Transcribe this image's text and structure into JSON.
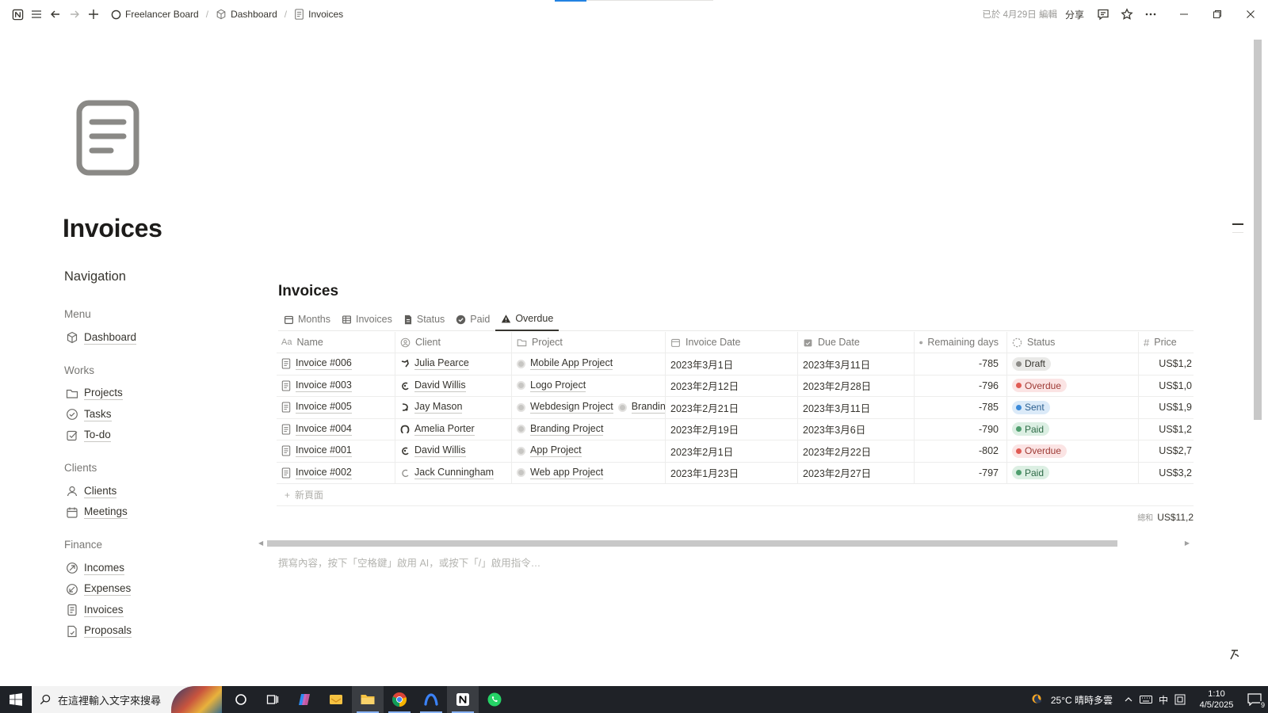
{
  "topbar": {
    "breadcrumbs": [
      "Freelancer Board",
      "Dashboard",
      "Invoices"
    ],
    "edited": "已於 4月29日 編輯",
    "share": "分享"
  },
  "page": {
    "title": "Invoices"
  },
  "nav": {
    "heading": "Navigation",
    "groups": [
      {
        "title": "Menu",
        "items": [
          {
            "label": "Dashboard",
            "icon": "cube-icon"
          }
        ]
      },
      {
        "title": "Works",
        "items": [
          {
            "label": "Projects",
            "icon": "folder-icon"
          },
          {
            "label": "Tasks",
            "icon": "check-circle-icon"
          },
          {
            "label": "To-do",
            "icon": "checkbox-icon"
          }
        ]
      },
      {
        "title": "Clients",
        "items": [
          {
            "label": "Clients",
            "icon": "person-icon"
          },
          {
            "label": "Meetings",
            "icon": "calendar-icon"
          }
        ]
      },
      {
        "title": "Finance",
        "items": [
          {
            "label": "Incomes",
            "icon": "income-icon"
          },
          {
            "label": "Expenses",
            "icon": "expense-icon"
          },
          {
            "label": "Invoices",
            "icon": "document-icon"
          },
          {
            "label": "Proposals",
            "icon": "proposal-icon"
          }
        ]
      }
    ]
  },
  "db": {
    "title": "Invoices",
    "tabs": [
      {
        "label": "Months",
        "icon": "calendar-icon",
        "active": false
      },
      {
        "label": "Invoices",
        "icon": "table-icon",
        "active": false
      },
      {
        "label": "Status",
        "icon": "doc-icon",
        "active": false
      },
      {
        "label": "Paid",
        "icon": "check-circle-filled-icon",
        "active": false
      },
      {
        "label": "Overdue",
        "icon": "warning-icon",
        "active": true
      }
    ],
    "columns": {
      "name": "Name",
      "client": "Client",
      "project": "Project",
      "invoice_date": "Invoice Date",
      "due_date": "Due Date",
      "remaining": "Remaining days",
      "status": "Status",
      "price": "Price"
    },
    "rows": [
      {
        "name": "Invoice #006",
        "client": "Julia Pearce",
        "projects": [
          "Mobile App Project"
        ],
        "invoice_date": "2023年3月1日",
        "due_date": "2023年3月11日",
        "remaining": "-785",
        "status": "Draft",
        "price": "US$1,2"
      },
      {
        "name": "Invoice #003",
        "client": "David Willis",
        "projects": [
          "Logo Project"
        ],
        "invoice_date": "2023年2月12日",
        "due_date": "2023年2月28日",
        "remaining": "-796",
        "status": "Overdue",
        "price": "US$1,0"
      },
      {
        "name": "Invoice #005",
        "client": "Jay Mason",
        "projects": [
          "Webdesign Project",
          "Brandin"
        ],
        "invoice_date": "2023年2月21日",
        "due_date": "2023年3月11日",
        "remaining": "-785",
        "status": "Sent",
        "price": "US$1,9"
      },
      {
        "name": "Invoice #004",
        "client": "Amelia Porter",
        "projects": [
          "Branding Project"
        ],
        "invoice_date": "2023年2月19日",
        "due_date": "2023年3月6日",
        "remaining": "-790",
        "status": "Paid",
        "price": "US$1,2"
      },
      {
        "name": "Invoice #001",
        "client": "David Willis",
        "projects": [
          "App Project"
        ],
        "invoice_date": "2023年2月1日",
        "due_date": "2023年2月22日",
        "remaining": "-802",
        "status": "Overdue",
        "price": "US$2,7"
      },
      {
        "name": "Invoice #002",
        "client": "Jack Cunningham",
        "projects": [
          "Web app Project"
        ],
        "invoice_date": "2023年1月23日",
        "due_date": "2023年2月27日",
        "remaining": "-797",
        "status": "Paid",
        "price": "US$3,2"
      }
    ],
    "new_page": "新頁面",
    "sum_label": "總和",
    "sum_value": "US$11,2",
    "placeholder": "撰寫內容，按下「空格鍵」啟用 AI，或按下「/」啟用指令…"
  },
  "status_colors": {
    "Draft": {
      "bg": "#e9e9e7",
      "dot": "#8d8c88",
      "fg": "#37352f"
    },
    "Overdue": {
      "bg": "#fbe4e4",
      "dot": "#e05b54",
      "fg": "#9e3b35"
    },
    "Sent": {
      "bg": "#dbeaf8",
      "dot": "#3b8ad9",
      "fg": "#2b5f8f"
    },
    "Paid": {
      "bg": "#dcefe3",
      "dot": "#4f9e6e",
      "fg": "#2e6b47"
    }
  },
  "taskbar": {
    "search_placeholder": "在這裡輸入文字來搜尋",
    "weather": "25°C 晴時多雲",
    "ime": "中",
    "time": "1:10",
    "date": "4/5/2025",
    "notification_count": "9"
  }
}
